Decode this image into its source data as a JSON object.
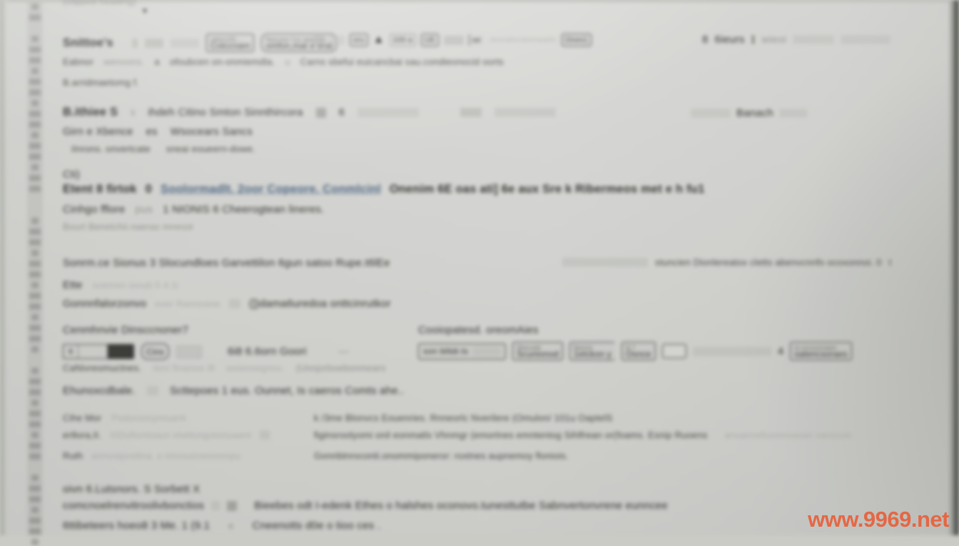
{
  "meta": {
    "capture_kind": "out-of-focus photograph of a computer display",
    "legibility": "body text is unreadable due to blur; only structure, the I-beam/triangle/chevron icons and the watermark resolve",
    "watermark": "www.9969.net"
  },
  "colors": {
    "screen_background": "#d7d8d2",
    "text": "#23241f",
    "faint_text": "#8e9089",
    "link": "#2d5f99",
    "button_border": "#2a2b26",
    "slab_fill": "#a8aaa2",
    "gutter_fill": "#babcb4",
    "bezel_dark": "#4c4f48",
    "watermark": "#e8603a"
  },
  "gutter": {
    "name": "line-number-gutter",
    "groups": [
      {
        "blanks": 0,
        "numbers": 2
      },
      {
        "blanks": 1,
        "numbers": 15
      },
      {
        "blanks": 2,
        "numbers": 13
      },
      {
        "blanks": 1,
        "numbers": 9
      },
      {
        "blanks": 1,
        "numbers": 7
      }
    ]
  },
  "top": {
    "cut_heading": "(clipped heading)",
    "chevron": "▾"
  },
  "sections": [
    {
      "name": "section-1",
      "heading": "Snittoe's",
      "heading_slabs": [
        10,
        26,
        40
      ],
      "buttons": [
        {
          "cap": "rattecn26-...",
          "label": "Cotccnam"
        },
        {
          "cap": "Nascose Cou aaacose",
          "label": "omfon,mat e erat"
        }
      ],
      "inline_group": {
        "slabs": [
          14,
          22
        ],
        "chips": [
          "oru",
          "100 a",
          "UE"
        ],
        "triangle": "▲",
        "trail_slab": 28,
        "bracket_chip": "ae",
        "faint_run": "Jeunaturatomea0n",
        "end_chip": "Ones1"
      },
      "right_group": {
        "glyph": "8",
        "word": "6ieurs",
        "ibeam": "I",
        "word2": "wieoi",
        "slabs": [
          58,
          70,
          96
        ]
      },
      "lines": [
        {
          "parts": [
            {
              "kind": "text",
              "value": "Eabnor"
            },
            {
              "kind": "faint",
              "value": "wenoons."
            },
            {
              "kind": "text",
              "value": "a"
            },
            {
              "kind": "text",
              "value": "ofoubcen  on-onmiemdla."
            },
            {
              "kind": "faint",
              "value": "u"
            },
            {
              "kind": "text",
              "value": "Carns  sbefui euicancbai  sau.condieonocid oorts"
            }
          ]
        },
        {
          "parts": [
            {
              "kind": "text",
              "value": "B.arridmaetomg f."
            }
          ]
        }
      ]
    },
    {
      "name": "section-2",
      "heading": "B.ithiee  S",
      "row": {
        "small": "ii",
        "text": "ihdeh Citino  Smton  Sinnthircora",
        "swatch": true,
        "glyph": "6",
        "slabs": [
          86,
          30,
          86
        ],
        "tail_word": "Banach",
        "tail_slab": 56
      },
      "lines": [
        {
          "parts": [
            {
              "kind": "text",
              "value": "Girn e  Xbence"
            },
            {
              "kind": "text",
              "value": "es"
            },
            {
              "kind": "text",
              "value": "Wsocears  Sancs"
            }
          ]
        },
        {
          "parts": [
            {
              "kind": "text",
              "value": "iInrons. onvertcate"
            },
            {
              "kind": "text",
              "value": "sneai  eoueern-dowe."
            }
          ]
        }
      ]
    },
    {
      "name": "section-3",
      "heading": "Cti)",
      "link_row": {
        "prefix": "Etent 8  firtok",
        "zero": "0",
        "link": "Soolormadlt. 2oor  Copeore. Conmlcinl",
        "rest": "Onenim 6E  oas ati]  6e  aux  Sre  k  Ribermeos  met  e  h  fu1"
      },
      "lines": [
        {
          "parts": [
            {
              "kind": "text",
              "value": "Cinhgo fflore"
            },
            {
              "kind": "faint",
              "value": "pus"
            },
            {
              "kind": "text",
              "value": "1  NIONIS 6  Cheerogtean lineres."
            }
          ]
        },
        {
          "parts": [
            {
              "kind": "faint",
              "value": "Bourt Benetchii.naeras  mnesst"
            }
          ]
        }
      ]
    },
    {
      "name": "section-4",
      "heading": "Sonrm.ce  Sionus   3  Slocundloes  Garvettilon  6gun   satoo  Rupe.t6lEe",
      "right_text": "stuncien  Dionlereatox cletts  abenvcnnfo  ocoxonnoi.   0",
      "right_tail": "t",
      "lines": [
        {
          "parts": [
            {
              "kind": "text",
              "value": "Ette"
            },
            {
              "kind": "faint",
              "value": "soemen ionub  5   4.1i"
            }
          ]
        },
        {
          "parts": [
            {
              "kind": "text",
              "value": "Gonnnfalorzonvo"
            },
            {
              "kind": "faint",
              "value": "ever   Rannoane"
            },
            {
              "kind": "text",
              "value": "(])dama6uredoa  onttcinrutkor"
            }
          ]
        }
      ]
    },
    {
      "name": "section-5",
      "left_heading": "Cenmhnvie  Dinsccnoner7",
      "right_heading": "Cooiopatesd. oreomAies",
      "controls": {
        "segmented": {
          "cells": [
            "6",
            "",
            ""
          ],
          "active_index": 2
        },
        "pill": "Cins",
        "mini_slab": 34,
        "text": "6i8  6.6orn     Goori",
        "dash": "—"
      },
      "right_buttons": [
        {
          "label": "son blitdr.ts",
          "slab": 40
        },
        {
          "cap": "Dhecodd",
          "label": "Scunionod"
        },
        {
          "cap": "Namctr",
          "label": "1etckon y"
        },
        {
          "cap": "N        ?",
          "label": "Osnce",
          "has_box": true
        },
        {
          "value": "4"
        },
        {
          "cap": "st.cocooomaten",
          "label": "oatencsoraes"
        }
      ],
      "lines": [
        {
          "parts": [
            {
              "kind": "text",
              "value": "CaNivreomuctnes."
            },
            {
              "kind": "faint",
              "value": "iieni  finanoe /8"
            },
            {
              "kind": "faint",
              "value": "wetemwgnox."
            },
            {
              "kind": "text",
              "value": "(Unnjorboebonmears"
            }
          ]
        },
        {
          "parts": [
            {
              "kind": "text",
              "value": "Ehunoxcdbale."
            },
            {
              "kind": "text",
              "value": "Scttepoes 1  eus. Ounnet, Is  caeros  Comts  ahe.."
            }
          ]
        }
      ]
    },
    {
      "name": "section-6",
      "left": [
        {
          "parts": [
            {
              "kind": "text",
              "value": "Cihe  Mor"
            },
            {
              "kind": "faint",
              "value": "Pedonomynnuerk"
            }
          ]
        },
        {
          "parts": [
            {
              "kind": "text",
              "value": "er8ora,II."
            },
            {
              "kind": "faint",
              "value": "IIIDuftontoaun vtwttungotonuaant"
            }
          ]
        },
        {
          "parts": [
            {
              "kind": "text",
              "value": "Ruth"
            },
            {
              "kind": "faint",
              "value": "annooipvottna.   x ninrouscennompu"
            }
          ]
        }
      ],
      "right": [
        {
          "parts": [
            {
              "kind": "text",
              "value": "k /3me  Blonvcs  Eouenries.  Rnneorlc  Nverilere  (Omulon/ 101u  OaptelS"
            }
          ]
        },
        {
          "parts": [
            {
              "kind": "text",
              "value": "figinsroolyomi onil eonmatls   Vhnmgr  (emortnes  emntentog  Sihlfrean or(foams.  Esnip Ruoens"
            },
            {
              "kind": "vfaint",
              "value": "anuannefuomnoaran  nanocon"
            }
          ]
        },
        {
          "parts": [
            {
              "kind": "text",
              "value": "Gonnbtnroconti.onommiponeror: roxtnes  aupnemoy floniois."
            }
          ]
        }
      ]
    },
    {
      "name": "section-7",
      "heading": "oivn  6.Lutsnors.  S  Sorbett  X",
      "lines": [
        {
          "parts": [
            {
              "kind": "text",
              "value": "comcnoelrenvitroolivbonctios"
            },
            {
              "kind": "swatchpair",
              "value": ""
            },
            {
              "kind": "text",
              "value": "Bieebes  odt I-edenk  Ethes o  halshes  oconovo.tunesttutbe  Sabnvertonvrene  eunncee"
            }
          ]
        },
        {
          "parts": [
            {
              "kind": "text",
              "value": "6ttibeteers  hoeo8  3  Me. 1  (9.1"
            },
            {
              "kind": "faint",
              "value": "e"
            },
            {
              "kind": "text",
              "value": "Cneenotts  d0e  o tioo  ces ."
            }
          ]
        }
      ]
    }
  ]
}
